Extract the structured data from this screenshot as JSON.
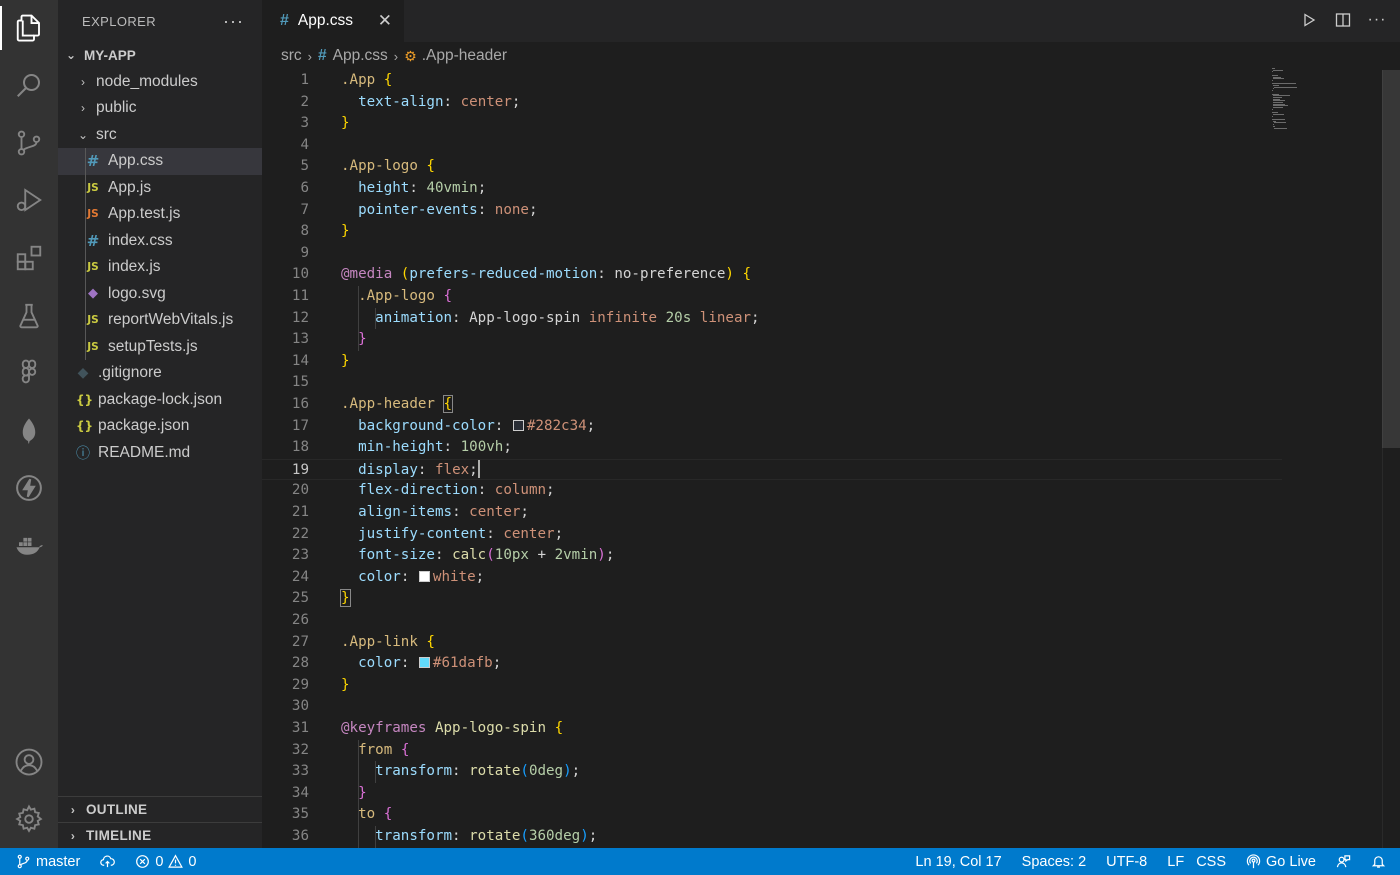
{
  "explorer": {
    "title": "EXPLORER",
    "more": "···",
    "project": "MY-APP",
    "items": [
      {
        "label": "node_modules",
        "kind": "folder-closed",
        "depth": 1
      },
      {
        "label": "public",
        "kind": "folder-closed",
        "depth": 1
      },
      {
        "label": "src",
        "kind": "folder-open",
        "depth": 1
      },
      {
        "label": "App.css",
        "kind": "css",
        "depth": 2,
        "icon": "#",
        "selected": true
      },
      {
        "label": "App.js",
        "kind": "js",
        "depth": 2,
        "icon": "JS"
      },
      {
        "label": "App.test.js",
        "kind": "jstest",
        "depth": 2,
        "icon": "JS"
      },
      {
        "label": "index.css",
        "kind": "css",
        "depth": 2,
        "icon": "#"
      },
      {
        "label": "index.js",
        "kind": "js",
        "depth": 2,
        "icon": "JS"
      },
      {
        "label": "logo.svg",
        "kind": "svg",
        "depth": 2,
        "icon": "◆"
      },
      {
        "label": "reportWebVitals.js",
        "kind": "js",
        "depth": 2,
        "icon": "JS"
      },
      {
        "label": "setupTests.js",
        "kind": "js",
        "depth": 2,
        "icon": "JS"
      },
      {
        "label": ".gitignore",
        "kind": "git",
        "depth": 1,
        "icon": "◆"
      },
      {
        "label": "package-lock.json",
        "kind": "json",
        "depth": 1,
        "icon": "{}"
      },
      {
        "label": "package.json",
        "kind": "json",
        "depth": 1,
        "icon": "{}"
      },
      {
        "label": "README.md",
        "kind": "info",
        "depth": 1,
        "icon": "ⓘ"
      }
    ],
    "outline": "OUTLINE",
    "timeline": "TIMELINE"
  },
  "tab": {
    "label": "App.css",
    "icon": "#",
    "close": "✕"
  },
  "breadcrumb": {
    "folder": "src",
    "file": "App.css",
    "symbol": ".App-header"
  },
  "editor": {
    "current_line": 19,
    "lines": [
      [
        [
          "sel",
          ".App"
        ],
        [
          "plain",
          " "
        ],
        [
          "b1",
          "{"
        ]
      ],
      [
        [
          "plain",
          "  "
        ],
        [
          "prop",
          "text-align"
        ],
        [
          "plain",
          ": "
        ],
        [
          "val",
          "center"
        ],
        [
          "plain",
          ";"
        ]
      ],
      [
        [
          "b1",
          "}"
        ]
      ],
      [],
      [
        [
          "sel",
          ".App-logo"
        ],
        [
          "plain",
          " "
        ],
        [
          "b1",
          "{"
        ]
      ],
      [
        [
          "plain",
          "  "
        ],
        [
          "prop",
          "height"
        ],
        [
          "plain",
          ": "
        ],
        [
          "num",
          "40vmin"
        ],
        [
          "plain",
          ";"
        ]
      ],
      [
        [
          "plain",
          "  "
        ],
        [
          "prop",
          "pointer-events"
        ],
        [
          "plain",
          ": "
        ],
        [
          "val",
          "none"
        ],
        [
          "plain",
          ";"
        ]
      ],
      [
        [
          "b1",
          "}"
        ]
      ],
      [],
      [
        [
          "at",
          "@media"
        ],
        [
          "plain",
          " "
        ],
        [
          "b1",
          "("
        ],
        [
          "prop",
          "prefers-reduced-motion"
        ],
        [
          "plain",
          ": no-preference"
        ],
        [
          "b1",
          ")"
        ],
        [
          "plain",
          " "
        ],
        [
          "b1",
          "{"
        ]
      ],
      [
        [
          "plain",
          "  "
        ],
        [
          "sel",
          ".App-logo"
        ],
        [
          "plain",
          " "
        ],
        [
          "b2",
          "{"
        ]
      ],
      [
        [
          "plain",
          "    "
        ],
        [
          "prop",
          "animation"
        ],
        [
          "plain",
          ": App-logo-spin "
        ],
        [
          "val",
          "infinite"
        ],
        [
          "plain",
          " "
        ],
        [
          "num",
          "20s"
        ],
        [
          "plain",
          " "
        ],
        [
          "val",
          "linear"
        ],
        [
          "plain",
          ";"
        ]
      ],
      [
        [
          "plain",
          "  "
        ],
        [
          "b2",
          "}"
        ]
      ],
      [
        [
          "b1",
          "}"
        ]
      ],
      [],
      [
        [
          "sel",
          ".App-header"
        ],
        [
          "plain",
          " "
        ],
        [
          "b1m",
          "{"
        ]
      ],
      [
        [
          "plain",
          "  "
        ],
        [
          "prop",
          "background-color"
        ],
        [
          "plain",
          ": "
        ],
        [
          "swatch",
          "#282c34"
        ],
        [
          "val",
          "#282c34"
        ],
        [
          "plain",
          ";"
        ]
      ],
      [
        [
          "plain",
          "  "
        ],
        [
          "prop",
          "min-height"
        ],
        [
          "plain",
          ": "
        ],
        [
          "num",
          "100vh"
        ],
        [
          "plain",
          ";"
        ]
      ],
      [
        [
          "plain",
          "  "
        ],
        [
          "prop",
          "display"
        ],
        [
          "plain",
          ": "
        ],
        [
          "val",
          "flex"
        ],
        [
          "plain",
          ";"
        ],
        [
          "cursor",
          ""
        ]
      ],
      [
        [
          "plain",
          "  "
        ],
        [
          "prop",
          "flex-direction"
        ],
        [
          "plain",
          ": "
        ],
        [
          "val",
          "column"
        ],
        [
          "plain",
          ";"
        ]
      ],
      [
        [
          "plain",
          "  "
        ],
        [
          "prop",
          "align-items"
        ],
        [
          "plain",
          ": "
        ],
        [
          "val",
          "center"
        ],
        [
          "plain",
          ";"
        ]
      ],
      [
        [
          "plain",
          "  "
        ],
        [
          "prop",
          "justify-content"
        ],
        [
          "plain",
          ": "
        ],
        [
          "val",
          "center"
        ],
        [
          "plain",
          ";"
        ]
      ],
      [
        [
          "plain",
          "  "
        ],
        [
          "prop",
          "font-size"
        ],
        [
          "plain",
          ": "
        ],
        [
          "fn",
          "calc"
        ],
        [
          "b2",
          "("
        ],
        [
          "num",
          "10px"
        ],
        [
          "plain",
          " + "
        ],
        [
          "num",
          "2vmin"
        ],
        [
          "b2",
          ")"
        ],
        [
          "plain",
          ";"
        ]
      ],
      [
        [
          "plain",
          "  "
        ],
        [
          "prop",
          "color"
        ],
        [
          "plain",
          ": "
        ],
        [
          "swatch",
          "#ffffff"
        ],
        [
          "val",
          "white"
        ],
        [
          "plain",
          ";"
        ]
      ],
      [
        [
          "b1m",
          "}"
        ]
      ],
      [],
      [
        [
          "sel",
          ".App-link"
        ],
        [
          "plain",
          " "
        ],
        [
          "b1",
          "{"
        ]
      ],
      [
        [
          "plain",
          "  "
        ],
        [
          "prop",
          "color"
        ],
        [
          "plain",
          ": "
        ],
        [
          "swatch",
          "#61dafb"
        ],
        [
          "val",
          "#61dafb"
        ],
        [
          "plain",
          ";"
        ]
      ],
      [
        [
          "b1",
          "}"
        ]
      ],
      [],
      [
        [
          "at",
          "@keyframes"
        ],
        [
          "plain",
          " "
        ],
        [
          "fn",
          "App-logo-spin"
        ],
        [
          "plain",
          " "
        ],
        [
          "b1",
          "{"
        ]
      ],
      [
        [
          "plain",
          "  "
        ],
        [
          "sel",
          "from"
        ],
        [
          "plain",
          " "
        ],
        [
          "b2",
          "{"
        ]
      ],
      [
        [
          "plain",
          "    "
        ],
        [
          "prop",
          "transform"
        ],
        [
          "plain",
          ": "
        ],
        [
          "fn",
          "rotate"
        ],
        [
          "b3",
          "("
        ],
        [
          "num",
          "0deg"
        ],
        [
          "b3",
          ")"
        ],
        [
          "plain",
          ";"
        ]
      ],
      [
        [
          "plain",
          "  "
        ],
        [
          "b2",
          "}"
        ]
      ],
      [
        [
          "plain",
          "  "
        ],
        [
          "sel",
          "to"
        ],
        [
          "plain",
          " "
        ],
        [
          "b2",
          "{"
        ]
      ],
      [
        [
          "plain",
          "    "
        ],
        [
          "prop",
          "transform"
        ],
        [
          "plain",
          ": "
        ],
        [
          "fn",
          "rotate"
        ],
        [
          "b3",
          "("
        ],
        [
          "num",
          "360deg"
        ],
        [
          "b3",
          ")"
        ],
        [
          "plain",
          ";"
        ]
      ]
    ]
  },
  "statusbar": {
    "branch": "master",
    "errors": "0",
    "warnings": "0",
    "position": "Ln 19, Col 17",
    "spaces": "Spaces: 2",
    "encoding": "UTF-8",
    "eol": "LF",
    "language": "CSS",
    "golive": "Go Live"
  },
  "colors": {
    "accent": "#007acc",
    "activity_bg": "#333333",
    "sidebar_bg": "#252526",
    "editor_bg": "#1e1e1e"
  }
}
